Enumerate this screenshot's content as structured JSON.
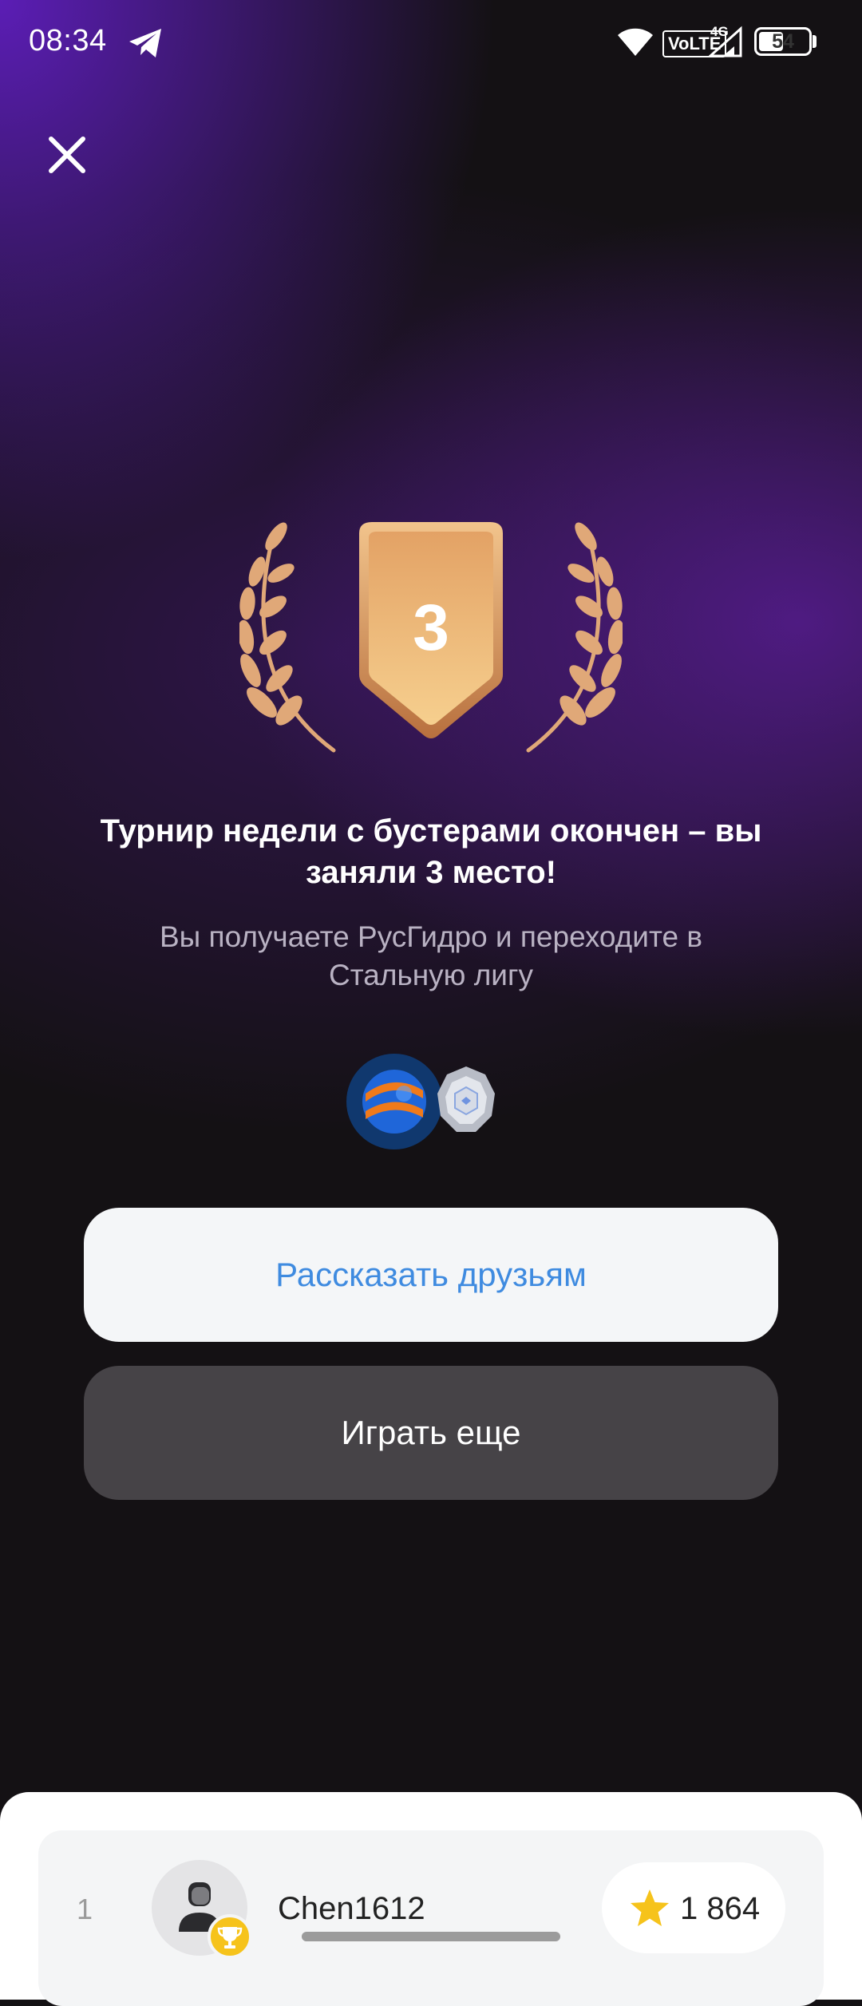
{
  "status_bar": {
    "time": "08:34",
    "battery": "54",
    "battery_level": 0.54,
    "network_label": "4G",
    "volte_label": "VoLTE",
    "icons": [
      "telegram-icon",
      "wifi-icon",
      "volte-icon",
      "signal-icon",
      "battery-icon"
    ]
  },
  "header": {
    "close_icon": "close-icon"
  },
  "award": {
    "place": "3",
    "colors": {
      "badge_top": "#e8a868",
      "badge_bottom": "#f5c98a",
      "laurel": "#e0a878"
    }
  },
  "result": {
    "headline": "Турнир недели с бустерами окончен – вы заняли 3 место!",
    "subline": "Вы получаете РусГидро и переходите в Стальную лигу"
  },
  "rewards": {
    "icons": [
      "rushydro-logo-icon",
      "steel-league-badge-icon"
    ]
  },
  "buttons": {
    "share_label": "Рассказать друзьям",
    "play_label": "Играть еще"
  },
  "leaderboard": {
    "rows": [
      {
        "rank": "1",
        "username": "Chen1612",
        "score": "1 864"
      }
    ]
  },
  "colors": {
    "accent_blue": "#3f8be0",
    "button_dark": "#464347",
    "button_light": "#f4f6f8",
    "background": "#141114",
    "purple_glow": "#5f1ebe"
  }
}
